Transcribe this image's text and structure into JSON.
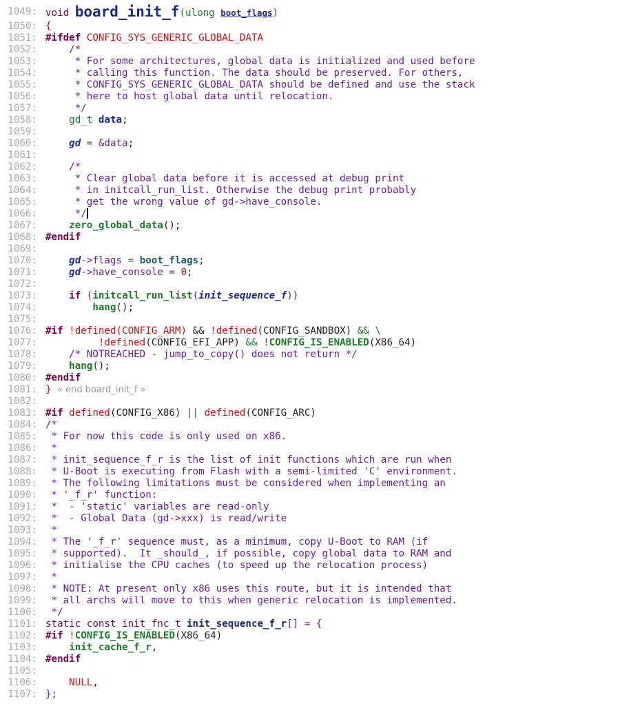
{
  "editor": {
    "line_numbers": [
      "1049:",
      "1050:",
      "1051:",
      "1052:",
      "1053:",
      "1054:",
      "1055:",
      "1056:",
      "1057:",
      "1058:",
      "1059:",
      "1060:",
      "1061:",
      "1062:",
      "1063:",
      "1064:",
      "1065:",
      "1066:",
      "1067:",
      "1068:",
      "1069:",
      "1070:",
      "1071:",
      "1072:",
      "1073:",
      "1074:",
      "1075:",
      "1076:",
      "1077:",
      "1078:",
      "1079:",
      "1080:",
      "1081:",
      "1082:",
      "1083:",
      "1084:",
      "1085:",
      "1086:",
      "1087:",
      "1088:",
      "1089:",
      "1090:",
      "1091:",
      "1092:",
      "1093:",
      "1094:",
      "1095:",
      "1096:",
      "1097:",
      "1098:",
      "1099:",
      "1100:",
      "1101:",
      "1102:",
      "1103:",
      "1104:",
      "1105:",
      "1106:",
      "1107:"
    ],
    "lines": {
      "l1049": {
        "void": "void",
        "fname": "board_init_f",
        "paren_open": "(",
        "ptype": "ulong",
        "pname": "boot_flags",
        "paren_close": ")"
      },
      "l1050": {
        "text": "{"
      },
      "l1051": {
        "directive": "#ifdef",
        "macro": "CONFIG_SYS_GENERIC_GLOBAL_DATA"
      },
      "l1052": {
        "text": "    /*"
      },
      "l1053": {
        "text": "     * For some architectures, global data is initialized and used before"
      },
      "l1054": {
        "text": "     * calling this function. The data should be preserved. For others,"
      },
      "l1055": {
        "text": "     * CONFIG_SYS_GENERIC_GLOBAL_DATA should be defined and use the stack"
      },
      "l1056": {
        "text": "     * here to host global data until relocation."
      },
      "l1057": {
        "text": "     */"
      },
      "l1058": {
        "type": "gd_t",
        "var": "data",
        "semi": ";"
      },
      "l1060": {
        "gd": "gd",
        "op": " = ",
        "rhs": "&data",
        "semi": ";"
      },
      "l1062": {
        "text": "    /*"
      },
      "l1063": {
        "text": "     * Clear global data before it is accessed at debug print"
      },
      "l1064": {
        "text": "     * in initcall_run_list. Otherwise the debug print probably"
      },
      "l1065": {
        "text": "     * get the wrong value of gd->have_console."
      },
      "l1066": {
        "text": "     */"
      },
      "l1067": {
        "fn": "zero_global_data",
        "rest": "();"
      },
      "l1068": {
        "directive": "#endif"
      },
      "l1070": {
        "gd": "gd",
        "arrow": "->",
        "member": "flags",
        "op": " = ",
        "rhs": "boot_flags",
        "semi": ";"
      },
      "l1071": {
        "gd": "gd",
        "arrow": "->",
        "member": "have_console",
        "op": " = ",
        "num": "0",
        "semi": ";"
      },
      "l1073": {
        "kw": "if",
        "open": " (",
        "fn": "initcall_run_list",
        "p": "(",
        "arg": "init_sequence_f",
        "close": "))"
      },
      "l1074": {
        "fn": "hang",
        "rest": "();"
      },
      "l1076": {
        "directive": "#if",
        "a": " !",
        "def1": "defined",
        "m1": "(CONFIG_ARM)",
        "and1": " && ",
        "ex": "!",
        "def2": "defined",
        "m2": "(CONFIG_SANDBOX)",
        "and2": " && \\"
      },
      "l1077": {
        "ex": "!",
        "def": "defined",
        "m1": "(CONFIG_EFI_APP)",
        "and": " && ",
        "ex2": "!",
        "fn": "CONFIG_IS_ENABLED",
        "m2": "(X86_64)"
      },
      "l1078": {
        "text": "    /* NOTREACHED - jump_to_copy() does not return */"
      },
      "l1079": {
        "fn": "hang",
        "rest": "();"
      },
      "l1080": {
        "directive": "#endif"
      },
      "l1081": {
        "brace": "} ",
        "fold": "« end board_init_f »"
      },
      "l1083": {
        "directive": "#if",
        "def1": " defined",
        "m1": "(CONFIG_X86)",
        "or": " || ",
        "def2": "defined",
        "m2": "(CONFIG_ARC)"
      },
      "l1084": {
        "text": "/*"
      },
      "l1085": {
        "text": " * For now this code is only used on x86."
      },
      "l1086": {
        "text": " *"
      },
      "l1087": {
        "text": " * init_sequence_f_r is the list of init functions which are run when"
      },
      "l1088": {
        "text": " * U-Boot is executing from Flash with a semi-limited 'C' environment."
      },
      "l1089": {
        "text": " * The following limitations must be considered when implementing an"
      },
      "l1090": {
        "text": " * '_f_r' function:"
      },
      "l1091": {
        "text": " *  - 'static' variables are read-only"
      },
      "l1092": {
        "text": " *  - Global Data (gd->xxx) is read/write"
      },
      "l1093": {
        "text": " *"
      },
      "l1094": {
        "text": " * The '_f_r' sequence must, as a minimum, copy U-Boot to RAM (if"
      },
      "l1095": {
        "text": " * supported).  It _should_, if possible, copy global data to RAM and"
      },
      "l1096": {
        "text": " * initialise the CPU caches (to speed up the relocation process)"
      },
      "l1097": {
        "text": " *"
      },
      "l1098": {
        "text": " * NOTE: At present only x86 uses this route, but it is intended that"
      },
      "l1099": {
        "text": " * all archs will move to this when generic relocation is implemented."
      },
      "l1100": {
        "text": " */"
      },
      "l1101": {
        "decl": "static const init_fnc_t ",
        "name": "init_sequence_f_r",
        "rest": "[] = {"
      },
      "l1102": {
        "directive": "#if",
        "ex": " !",
        "fn": "CONFIG_IS_ENABLED",
        "m": "(X86_64)"
      },
      "l1103": {
        "fn": "init_cache_f_r",
        "rest": ","
      },
      "l1104": {
        "directive": "#endif"
      },
      "l1106": {
        "mac": "NULL",
        "rest": ","
      },
      "l1107": {
        "text": "};"
      }
    }
  },
  "colors": {
    "keyword": "#7f0055",
    "macro": "#d01010",
    "comment": "#6a1b9a",
    "function": "#1a7a2a",
    "variable": "#1a2aa0",
    "line_number": "#a8a8a8"
  }
}
